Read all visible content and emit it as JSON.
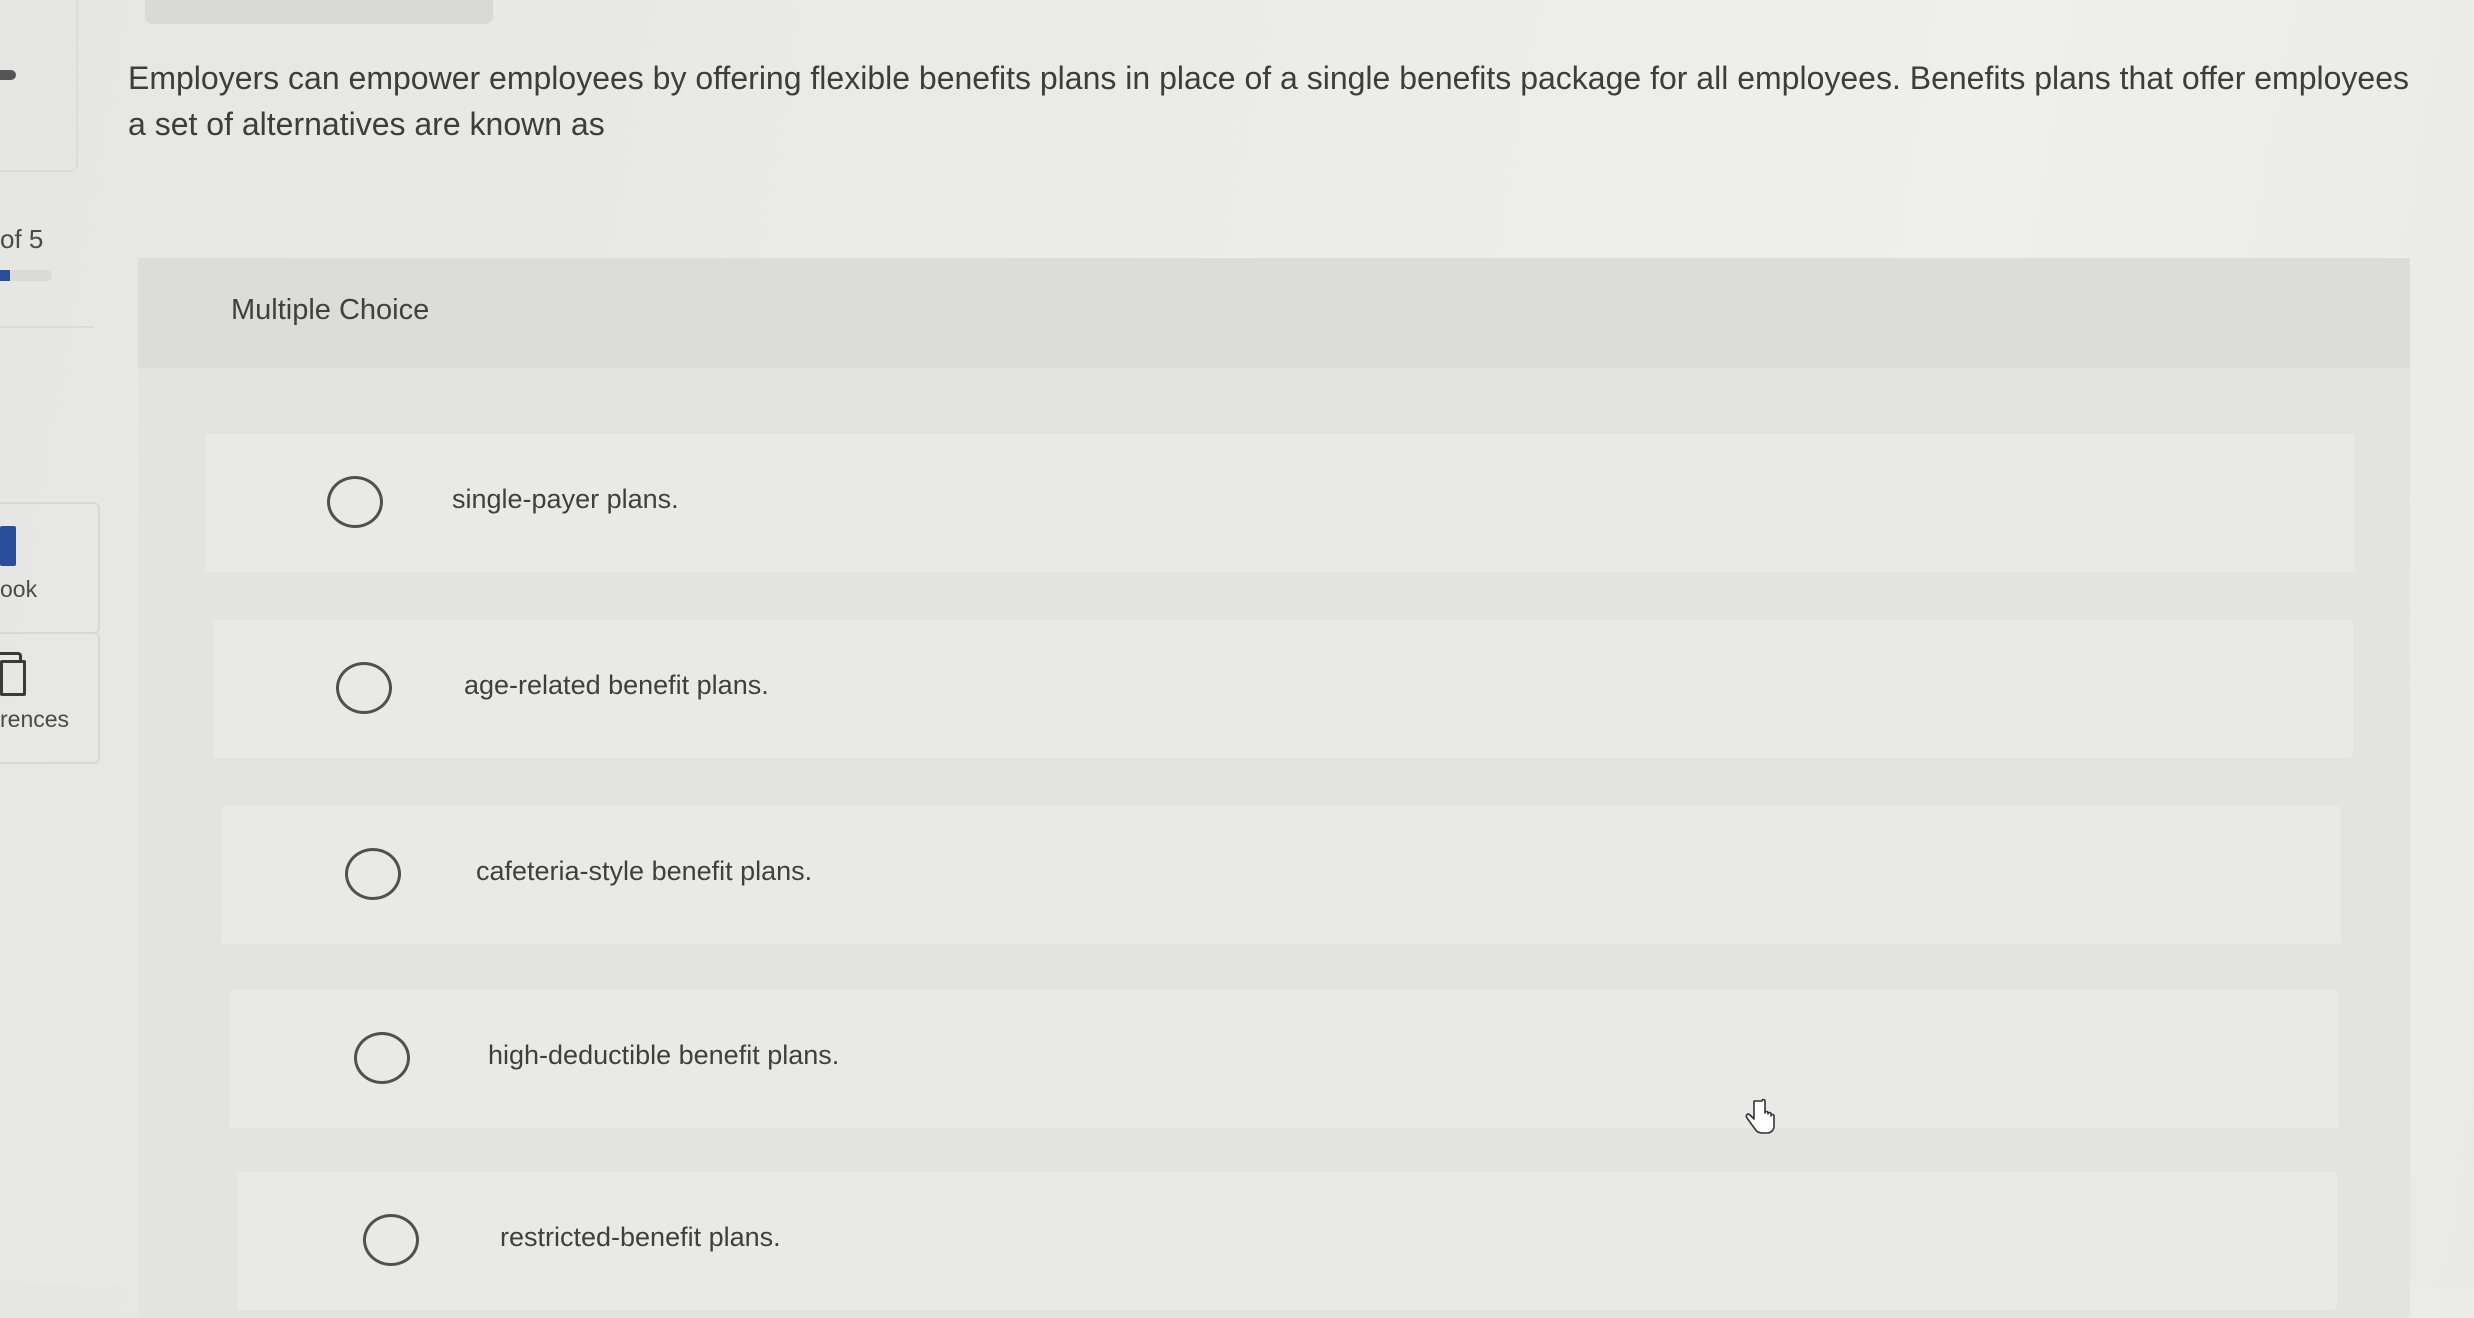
{
  "question": {
    "text": "Employers can empower employees by offering flexible benefits plans in place of a single benefits package for all employees. Benefits plans that offer employees a set of alternatives are known as"
  },
  "sidebar": {
    "progress_text": "of 5",
    "progress_fraction": 0.2,
    "tools": [
      {
        "label": "ook",
        "icon": "book-icon"
      },
      {
        "label": "rences",
        "icon": "references-icon"
      }
    ]
  },
  "mc": {
    "label": "Multiple Choice",
    "options": [
      {
        "text": "single-payer plans."
      },
      {
        "text": "age-related benefit plans."
      },
      {
        "text": "cafeteria-style benefit plans."
      },
      {
        "text": "high-deductible benefit plans."
      },
      {
        "text": "restricted-benefit plans."
      }
    ]
  },
  "colors": {
    "accent": "#2a4f9a",
    "panel": "#e3e3e0"
  }
}
